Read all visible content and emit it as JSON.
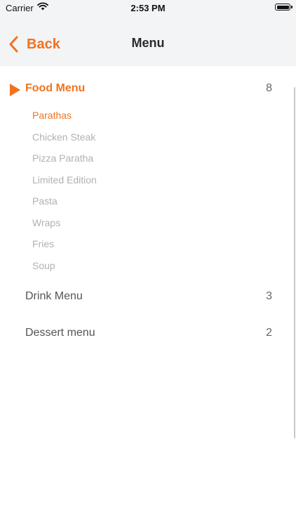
{
  "status_bar": {
    "carrier": "Carrier",
    "time": "2:53 PM",
    "battery_level": 1.0
  },
  "nav": {
    "back_label": "Back",
    "title": "Menu"
  },
  "colors": {
    "accent": "#f07320",
    "subitem_inactive": "#b1b1b1",
    "bar_background": "#f3f4f6"
  },
  "menu": {
    "categories": [
      {
        "name": "Food Menu",
        "count": "8",
        "expanded": true,
        "items": [
          "Parathas",
          "Chicken Steak",
          "Pizza Paratha",
          "Limited Edition",
          "Pasta",
          "Wraps",
          "Fries",
          "Soup"
        ]
      },
      {
        "name": "Drink Menu",
        "count": "3",
        "expanded": false
      },
      {
        "name": "Dessert menu",
        "count": "2",
        "expanded": false
      }
    ]
  }
}
